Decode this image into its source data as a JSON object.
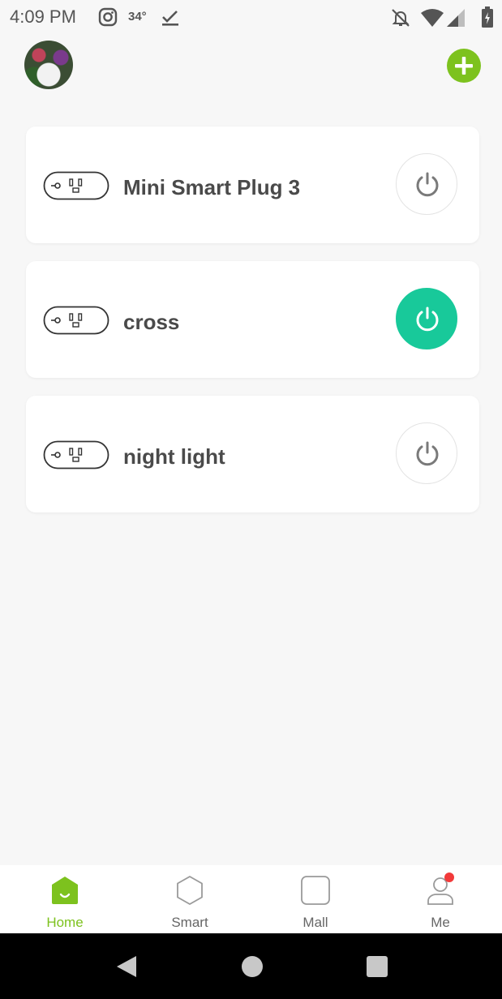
{
  "status_bar": {
    "time": "4:09 PM",
    "temperature": "34°",
    "icons": [
      "instagram-icon",
      "checkmark-icon",
      "bell-off-icon",
      "wifi-icon",
      "signal-icon",
      "battery-icon"
    ]
  },
  "header": {
    "avatar": "profile-avatar",
    "add_icon": "plus-icon"
  },
  "devices": [
    {
      "name": "Mini Smart Plug 3",
      "power": "off"
    },
    {
      "name": "cross",
      "power": "on"
    },
    {
      "name": "night light",
      "power": "off"
    }
  ],
  "bottom_nav": {
    "items": [
      {
        "label": "Home",
        "icon": "home-icon",
        "active": true
      },
      {
        "label": "Smart",
        "icon": "hexagon-icon",
        "active": false
      },
      {
        "label": "Mall",
        "icon": "bag-icon",
        "active": false
      },
      {
        "label": "Me",
        "icon": "person-icon",
        "active": false,
        "badge": true
      }
    ]
  },
  "system_nav": {
    "icons": [
      "back-icon",
      "home-circle-icon",
      "recents-icon"
    ]
  },
  "colors": {
    "accent_green": "#7dc21e",
    "power_on": "#18c99a",
    "background": "#f7f7f7",
    "badge_red": "#f23a3a"
  }
}
